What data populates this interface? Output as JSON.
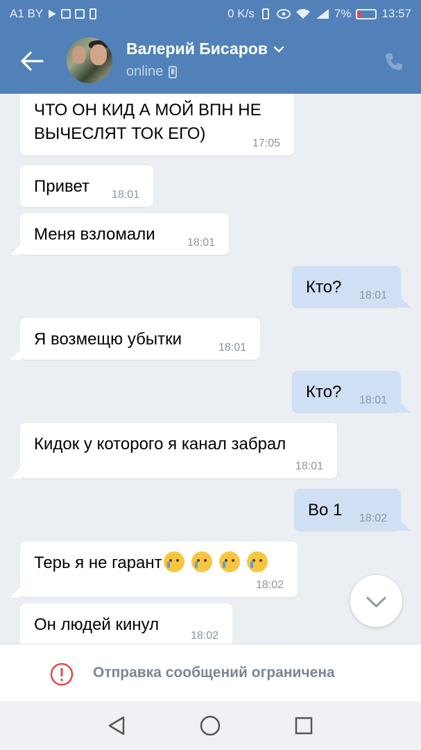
{
  "status_bar": {
    "carrier": "A1 BY",
    "net_speed": "0 K/s",
    "battery": "7%",
    "time": "13:57"
  },
  "header": {
    "contact_name": "Валерий Бисаров",
    "presence": "online"
  },
  "messages": [
    {
      "text": "ЧТО ОН КИД А МОЙ ВПН НЕ\nВЫЧЕСЛЯТ ТОК ЕГО)",
      "time": "17:05",
      "direction": "incoming"
    },
    {
      "text": "Привет",
      "time": "18:01",
      "direction": "incoming"
    },
    {
      "text": "Меня взломали",
      "time": "18:01",
      "direction": "incoming"
    },
    {
      "text": "Кто?",
      "time": "18:01",
      "direction": "outgoing"
    },
    {
      "text": "Я возмещю убытки",
      "time": "18:01",
      "direction": "incoming"
    },
    {
      "text": "Кто?",
      "time": "18:01",
      "direction": "outgoing"
    },
    {
      "text": "Кидок у которого я канал забрал",
      "time": "18:01",
      "direction": "incoming"
    },
    {
      "text": "Во 1",
      "time": "18:02",
      "direction": "outgoing"
    },
    {
      "text": "Терь я не гарант",
      "emoji": "crying-face",
      "emoji_count": 4,
      "time": "18:02",
      "direction": "incoming"
    },
    {
      "text": "Он людей кинул",
      "time": "18:02",
      "direction": "incoming"
    }
  ],
  "composer": {
    "notice": "Отправка сообщений ограничена"
  },
  "icons": {
    "back": "arrow-left-icon",
    "phone": "phone-icon",
    "warning": "exclamation-circle-icon",
    "scroll": "chevron-down-icon",
    "nav": [
      "triangle-back-icon",
      "circle-home-icon",
      "square-recents-icon"
    ]
  },
  "colors": {
    "header_bg": "#5181b8",
    "incoming_bubble": "#ffffff",
    "outgoing_bubble": "#cfe0f5",
    "chat_bg": "#ebeef2",
    "warning_red": "#e64646"
  }
}
